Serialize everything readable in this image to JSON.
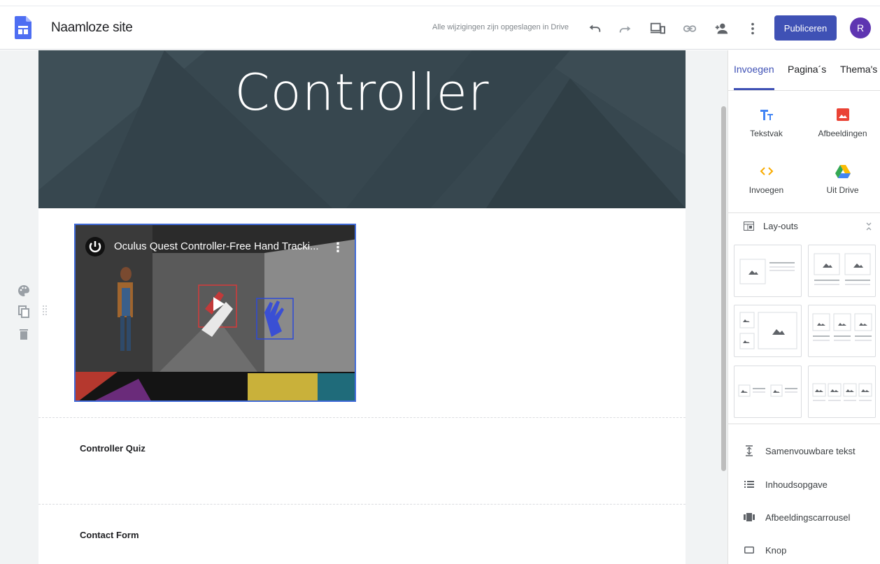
{
  "app": {
    "site_title": "Naamloze site",
    "saved_status": "Alle wijzigingen zijn opgeslagen in Drive",
    "publish_label": "Publiceren",
    "avatar_initial": "R",
    "brand_color": "#3f51b5"
  },
  "toolbar": {
    "icons": [
      "undo-icon",
      "redo-icon",
      "preview-devices-icon",
      "link-icon",
      "share-add-person-icon",
      "more-vert-icon"
    ]
  },
  "page": {
    "hero_title": "Controller",
    "video": {
      "title": "Oculus Quest Controller-Free Hand Tracki...",
      "kebab": "⋮"
    },
    "sections": [
      {
        "label": "Controller Quiz"
      },
      {
        "label": "Contact Form"
      }
    ]
  },
  "panel": {
    "tabs": [
      {
        "label": "Invoegen",
        "active": true
      },
      {
        "label": "Pagina´s",
        "active": false
      },
      {
        "label": "Thema's",
        "active": false
      }
    ],
    "insert_items": [
      {
        "label": "Tekstvak",
        "icon": "text-box-icon"
      },
      {
        "label": "Afbeeldingen",
        "icon": "image-icon"
      },
      {
        "label": "Invoegen",
        "icon": "embed-code-icon"
      },
      {
        "label": "Uit Drive",
        "icon": "drive-icon"
      }
    ],
    "layouts_label": "Lay-outs",
    "content_blocks": [
      {
        "label": "Samenvouwbare tekst",
        "icon": "collapsible-text-icon"
      },
      {
        "label": "Inhoudsopgave",
        "icon": "table-of-contents-icon"
      },
      {
        "label": "Afbeeldingscarrousel",
        "icon": "image-carousel-icon"
      },
      {
        "label": "Knop",
        "icon": "button-icon"
      }
    ]
  }
}
